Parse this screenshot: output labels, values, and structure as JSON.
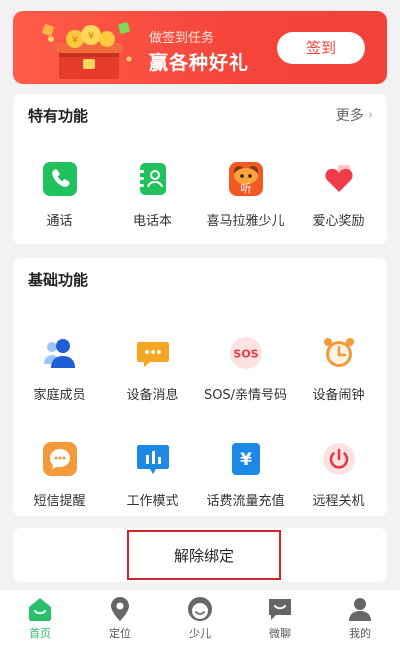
{
  "banner": {
    "subtitle": "做签到任务",
    "title": "赢各种好礼",
    "button_label": "签到"
  },
  "special": {
    "title": "特有功能",
    "more_label": "更多",
    "items": [
      {
        "label": "通话",
        "icon": "phone-icon"
      },
      {
        "label": "电话本",
        "icon": "phonebook-icon"
      },
      {
        "label": "喜马拉雅少儿",
        "icon": "ximalaya-kids-icon"
      },
      {
        "label": "爱心奖励",
        "icon": "heart-reward-icon"
      }
    ]
  },
  "basic": {
    "title": "基础功能",
    "items": [
      {
        "label": "家庭成员",
        "icon": "family-members-icon"
      },
      {
        "label": "设备消息",
        "icon": "device-message-icon"
      },
      {
        "label": "SOS/亲情号码",
        "icon": "sos-icon"
      },
      {
        "label": "设备闹钟",
        "icon": "alarm-clock-icon"
      },
      {
        "label": "短信提醒",
        "icon": "sms-reminder-icon"
      },
      {
        "label": "工作模式",
        "icon": "work-mode-icon"
      },
      {
        "label": "话费流量充值",
        "icon": "recharge-icon"
      },
      {
        "label": "远程关机",
        "icon": "remote-shutdown-icon"
      }
    ]
  },
  "unbind": {
    "label": "解除绑定"
  },
  "tabbar": {
    "active_color": "#2bbf6a",
    "tabs": [
      {
        "label": "首页",
        "icon": "home-icon",
        "active": true
      },
      {
        "label": "定位",
        "icon": "location-icon",
        "active": false
      },
      {
        "label": "少儿",
        "icon": "kids-icon",
        "active": false
      },
      {
        "label": "微聊",
        "icon": "chat-icon",
        "active": false
      },
      {
        "label": "我的",
        "icon": "profile-icon",
        "active": false
      }
    ]
  },
  "colors": {
    "banner_red": "#f3413a",
    "green": "#2bbf6a",
    "blue": "#1e88e5",
    "orange": "#f59a3a"
  }
}
